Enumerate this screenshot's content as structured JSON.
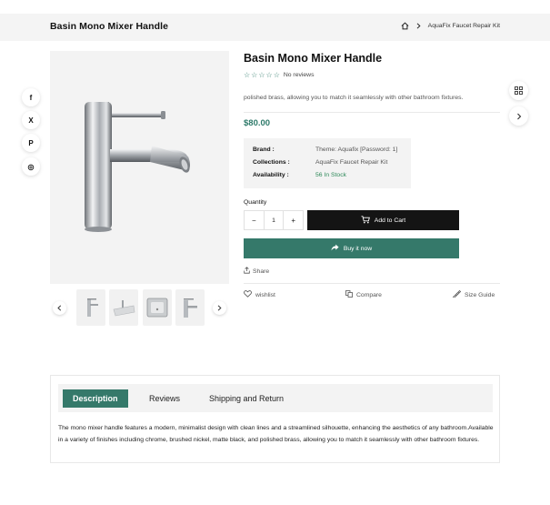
{
  "header": {
    "page_title": "Basin Mono Mixer Handle",
    "breadcrumb_current": "AquaFix Faucet Repair Kit"
  },
  "social": [
    {
      "name": "facebook",
      "glyph": "f"
    },
    {
      "name": "x-twitter",
      "glyph": "X"
    },
    {
      "name": "pinterest",
      "glyph": "P"
    },
    {
      "name": "instagram",
      "glyph": "◎"
    }
  ],
  "product": {
    "title": "Basin Mono Mixer Handle",
    "rating_stars": 0,
    "reviews_label": "No reviews",
    "short_description": "polished brass, allowing you to match it seamlessly with other bathroom fixtures.",
    "price": "$80.00",
    "info": {
      "brand_label": "Brand :",
      "brand_value": "Theme: Aquafix [Password: 1]",
      "collections_label": "Collections :",
      "collections_value": "AquaFix Faucet Repair Kit",
      "availability_label": "Availability :",
      "availability_value": "56 In Stock"
    },
    "quantity_label": "Quantity",
    "quantity_value": "1",
    "qty_minus": "−",
    "qty_plus": "+",
    "add_to_cart_label": "Add to Cart",
    "buy_now_label": "Buy it now",
    "share_label": "Share",
    "wishlist_label": "wishlist",
    "compare_label": "Compare",
    "size_guide_label": "Size Guide"
  },
  "thumbnails": [
    "faucet-tall",
    "basin-vessel",
    "basin-square",
    "faucet-side"
  ],
  "tabs": {
    "items": [
      "Description",
      "Reviews",
      "Shipping and Return"
    ],
    "active": "Description",
    "description_text": "The mono mixer handle features a modern, minimalist design with clean lines and a streamlined silhouette, enhancing the aesthetics of any bathroom.Available in a variety of finishes including chrome, brushed nickel, matte black, and polished brass, allowing you to match it seamlessly with other bathroom fixtures."
  },
  "colors": {
    "accent": "#35796a",
    "price": "#2e7a6a",
    "stock": "#2f8a5a",
    "dark_button": "#141414"
  }
}
